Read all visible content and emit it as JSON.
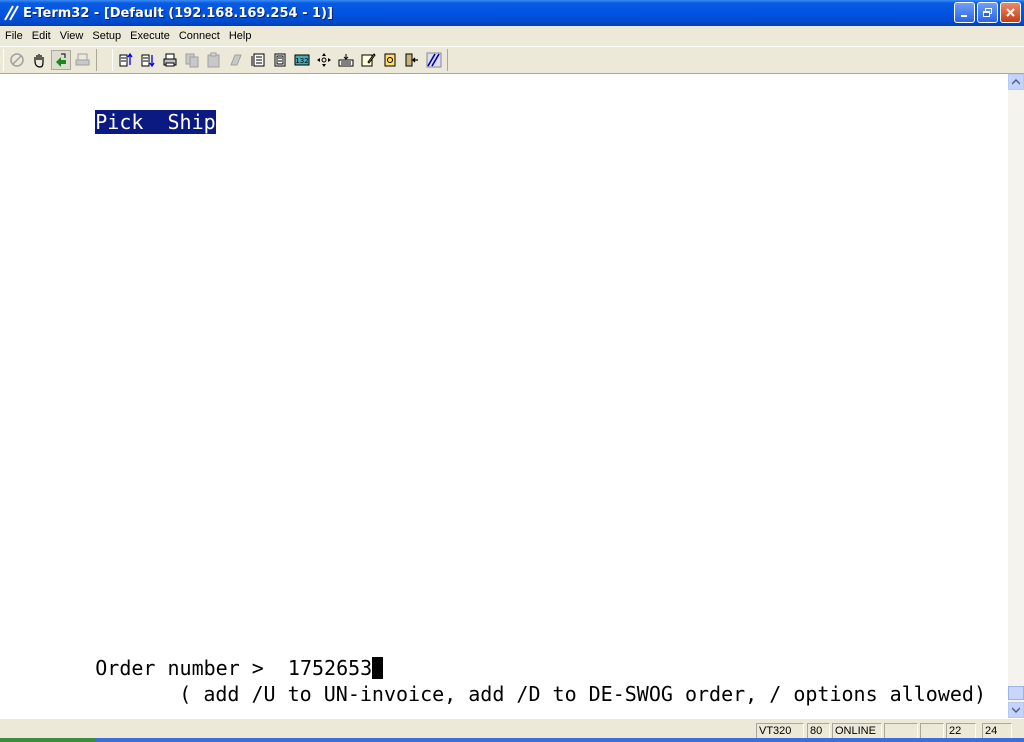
{
  "window": {
    "title": "E-Term32 - [Default (192.168.169.254 - 1)]"
  },
  "menu": {
    "items": [
      "File",
      "Edit",
      "View",
      "Setup",
      "Execute",
      "Connect",
      "Help"
    ]
  },
  "toolbar": {
    "group1": [
      "disconnect-icon",
      "hand-icon",
      "connect-icon",
      "print-screen-icon"
    ],
    "group2": [
      "send-file-icon",
      "receive-file-icon",
      "print-icon",
      "copy-icon",
      "paste-icon",
      "erase-icon",
      "page-icon",
      "page-alt-icon",
      "columns-132-icon",
      "move-icon",
      "keyboard-icon",
      "edit-icon",
      "script-icon",
      "exit-icon",
      "logo-icon"
    ],
    "columns_label": "132"
  },
  "terminal": {
    "header": "Pick  Ship",
    "prompt_label": "Order number >  ",
    "prompt_value": "1752653",
    "hint": "( add /U to UN-invoice, add /D to DE-SWOG order, / options allowed)"
  },
  "status": {
    "emulation": "VT320",
    "columns": "80",
    "state": "ONLINE",
    "blank1": "",
    "blank2": "",
    "row": "22",
    "col": "24"
  },
  "colors": {
    "highlight_bg": "#0a1a80",
    "titlebar": "#0054e3"
  }
}
